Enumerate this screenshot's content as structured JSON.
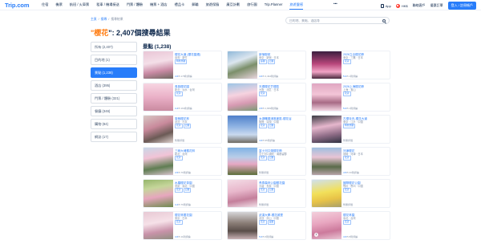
{
  "nav": {
    "logo": "Trip.com",
    "items": [
      "住宿",
      "機票",
      "航班 / 火車票",
      "租車 / 機場接送",
      "門票 / 體驗",
      "機票 + 酒店",
      "禮品卡",
      "郵輪",
      "旅遊保險",
      "廣亞計劃",
      "旅行團",
      "Trip.Planner",
      "旅遊靈感"
    ],
    "active_index": 12,
    "more": "•••",
    "app": "App",
    "currency": "HK$",
    "support": "聯絡客戶",
    "orders": "優惠訂單",
    "login": "登入 / 註冊帳戶"
  },
  "breadcrumb": [
    "主頁",
    "搜尋",
    "搜尋結果"
  ],
  "title": {
    "prefix": "\"",
    "keyword": "櫻花",
    "suffix": "\": 2,407個搜尋結果"
  },
  "search": {
    "placeholder": "目的地、景點、酒店等"
  },
  "sidebar": [
    {
      "label": "所有 (2,407)"
    },
    {
      "label": "目的地 (1)"
    },
    {
      "label": "景點 (1,238)"
    },
    {
      "label": "酒店 (395)"
    },
    {
      "label": "門票 / 體驗 (321)"
    },
    {
      "label": "餐廳 (346)"
    },
    {
      "label": "購物 (84)"
    },
    {
      "label": "網誌 (17)"
    }
  ],
  "sidebar_active": 2,
  "results_heading": "景點 (1,238)",
  "cards": [
    {
      "name": "櫻花大道 (櫻花園連)",
      "loc": "臺灣 · 新竹",
      "tags": [
        "特色景觀"
      ],
      "score": "4.6",
      "reviews": "/5 178則評論",
      "palette": "p1"
    },
    {
      "name": "新宿御苑",
      "loc": "東京 · 新宿 · 日本",
      "tags": [
        "庭園",
        "公園"
      ],
      "score": "4.6",
      "reviews": "/5 3,494則評論",
      "palette": "p2"
    },
    {
      "name": "2026立合櫻花節",
      "loc": "東京 · 三鷹 · 日本",
      "tags": [
        "花卉"
      ],
      "score": "5.0",
      "reviews": "/5 1則評論",
      "palette": "p3"
    },
    {
      "name": "貴族櫻花園",
      "loc": "新北 · 淡水 · 台灣",
      "tags": [
        "花卉"
      ],
      "score": "4.4",
      "reviews": "/5 164則評論",
      "palette": "p4"
    },
    {
      "name": "天德櫻花芒櫻區",
      "loc": "大阪 · 北區 · 日本",
      "tags": [
        "花卉"
      ],
      "score": "4.5",
      "reviews": "/5 1,669則評論",
      "palette": "p5"
    },
    {
      "name": "2026上海櫻花節",
      "loc": "上海 · 宝山",
      "tags": [
        "花卉"
      ],
      "score": "5.0",
      "reviews": "/5 1則評論",
      "palette": "p6"
    },
    {
      "name": "靈巷櫻花林",
      "loc": "武漢 · 日本",
      "tags": [
        "花卉",
        "公園"
      ],
      "score": "",
      "reviews": "暫無評價",
      "palette": "p7"
    },
    {
      "name": "太湖黿頭渚風景區-櫻花谷",
      "loc": "無錫 · 濱湖 · 中國",
      "tags": [
        "花卉",
        "公園"
      ],
      "score": "4.6",
      "reviews": "/5 95則評論",
      "palette": "p8"
    },
    {
      "name": "古櫻寺內-櫻花大道",
      "loc": "東京 · 江戶 · 中國",
      "tags": [
        "特色景觀"
      ],
      "score": "",
      "reviews": "暫無評價",
      "palette": "p9"
    },
    {
      "name": "三峽大埔櫻花林",
      "loc": "新北 · 台灣",
      "tags": [
        "花卉"
      ],
      "score": "4.5",
      "reviews": "/5 76則評論",
      "palette": "p10"
    },
    {
      "name": "富士河口湖櫻花節",
      "loc": "富士河口湖町 · 南都留郡",
      "tags": [
        "花卉",
        "公園"
      ],
      "score": "",
      "reviews": "暫無評價",
      "palette": "p11"
    },
    {
      "name": "河津櫻花",
      "loc": "靜岡 · 河津 · 日本",
      "tags": [
        "花卉"
      ],
      "score": "4.5",
      "reviews": "/5 33則評論",
      "palette": "p12"
    },
    {
      "name": "水磨櫻花茶園",
      "loc": "重慶 · 渝北 · 中國",
      "tags": [
        "花卉",
        "公園"
      ],
      "score": "4.4",
      "reviews": "/5 76則評論",
      "palette": "p13"
    },
    {
      "name": "長泰森林公園櫻花園",
      "loc": "大塘 · 長泰 · 中國",
      "tags": [
        "花卉",
        "公園"
      ],
      "score": "",
      "reviews": "暫無評價",
      "palette": "p14"
    },
    {
      "name": "國際櫻花公園",
      "loc": "鄂州 · 鄂州 · 中國",
      "tags": [
        "花卉"
      ],
      "score": "",
      "reviews": "暫無評價",
      "palette": "p15"
    },
    {
      "name": "櫻花林櫻花園",
      "loc": "東京 · 日本",
      "tags": [
        "花卉"
      ],
      "score": "4.6",
      "reviews": "/5 11則評論",
      "palette": "p16"
    },
    {
      "name": "武漢大學-櫻花城堡",
      "loc": "武漢 · 洪山 · 中國",
      "tags": [
        "花卉",
        "古蹟"
      ],
      "score": "5.0",
      "reviews": "/5 6則評論",
      "palette": "p17",
      "play": false
    },
    {
      "name": "櫻花林園",
      "loc": "臺北 · 台灣",
      "tags": [
        "花卉"
      ],
      "score": "4.6",
      "reviews": "/5 8則評論",
      "palette": "p18",
      "play": true
    }
  ]
}
